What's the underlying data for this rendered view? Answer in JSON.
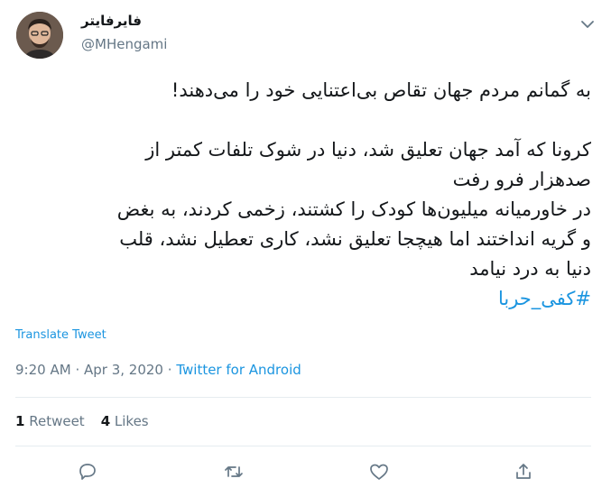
{
  "user": {
    "display_name": "فایرفایتر",
    "handle": "@MHengami"
  },
  "tweet": {
    "lines": [
      "به گمانم مردم جهان تقاص بی‌اعتنایی خود را می‌دهند!",
      "",
      "کرونا که آمد جهان تعلیق شد، دنیا در شوک تلفات کمتر از",
      "صدهزار فرو رفت",
      "در خاورمیانه میلیون‌ها کودک را کشتند، زخمی کردند، به بغض",
      "و گریه انداختند اما هیچجا تعلیق نشد، کاری تعطیل نشد، قلب",
      "دنیا به درد نیامد"
    ],
    "hashtag": "#کفی_حربا"
  },
  "translate_label": "Translate Tweet",
  "meta": {
    "time": "9:20 AM",
    "separator": "·",
    "date": "Apr 3, 2020",
    "source": "Twitter for Android"
  },
  "stats": {
    "retweets_count": "1",
    "retweets_label": "Retweet",
    "likes_count": "4",
    "likes_label": "Likes"
  },
  "icons": {
    "reply": "reply-icon",
    "retweet": "retweet-icon",
    "like": "heart-icon",
    "share": "share-icon",
    "more": "chevron-down-icon"
  },
  "colors": {
    "link": "#1b95e0",
    "secondary": "#657786",
    "text": "#14171a"
  }
}
